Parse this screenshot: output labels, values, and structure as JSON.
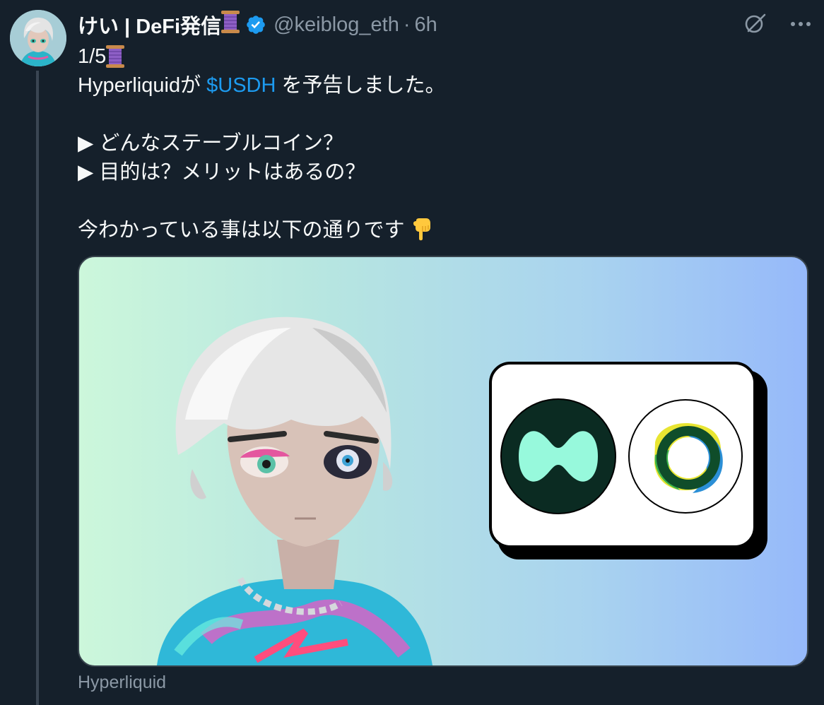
{
  "tweet": {
    "display_name": "けい | DeFi発信",
    "handle": "@keiblog_eth",
    "separator": "·",
    "time": "6h",
    "lines": {
      "counter": "1/5",
      "line1_pre": "Hyperliquidが ",
      "cashtag": "$USDH",
      "line1_post": " を予告しました。",
      "bullet1": "▶ どんなステーブルコイン？",
      "bullet2": "▶ 目的は？メリットはあるの？",
      "closing": "今わかっている事は以下の通りです"
    },
    "media_source": "Hyperliquid"
  },
  "icons": {
    "verified": "verified-badge-icon",
    "grok": "grok-icon",
    "more": "more-icon",
    "spool": "spool-emoji",
    "pointing_down": "backhand-index-pointing-down-emoji"
  },
  "colors": {
    "background": "#15202b",
    "text": "#f7f9f9",
    "secondary_text": "#8b98a5",
    "link": "#1d9bf0",
    "verified": "#1d9bf0"
  }
}
